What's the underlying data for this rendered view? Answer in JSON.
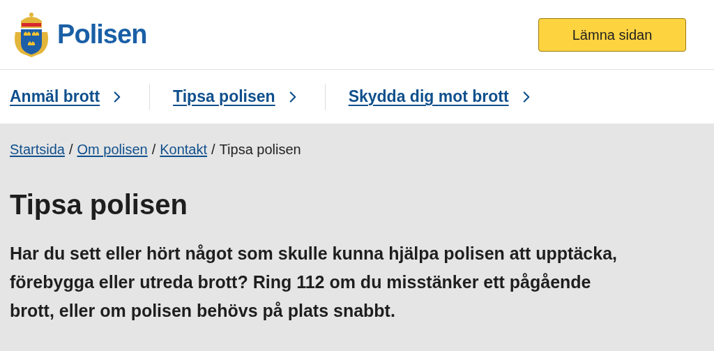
{
  "header": {
    "logo_text": "Polisen",
    "leave_button": "Lämna sidan"
  },
  "nav": [
    {
      "label": "Anmäl brott"
    },
    {
      "label": "Tipsa polisen"
    },
    {
      "label": "Skydda dig mot brott"
    }
  ],
  "breadcrumb": {
    "separator": "/",
    "items": [
      {
        "label": "Startsida",
        "kind": "link"
      },
      {
        "label": "Om polisen",
        "kind": "link"
      },
      {
        "label": "Kontakt",
        "kind": "link"
      },
      {
        "label": "Tipsa polisen",
        "kind": "current"
      }
    ]
  },
  "title": "Tipsa polisen",
  "intro": "Har du sett eller hört något som skulle kunna hjälpa polisen att upptäcka, förebygga eller utreda brott? Ring 112 om du misstänker ett pågående brott, eller om polisen behövs på plats snabbt."
}
